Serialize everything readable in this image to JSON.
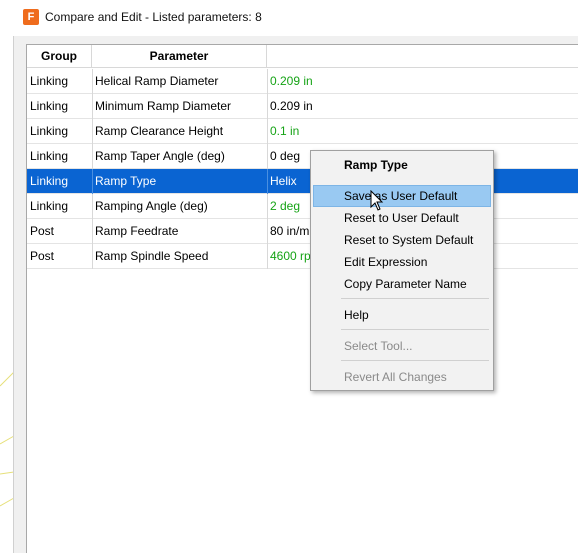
{
  "window": {
    "title": "Compare and Edit - Listed parameters: 8",
    "icon_letter": "F",
    "icon_color": "#ef6c1d"
  },
  "table": {
    "headers": [
      "Group",
      "Parameter",
      ""
    ],
    "rows": [
      {
        "group": "Linking",
        "parameter": "Helical Ramp Diameter",
        "value": "0.209 in",
        "modified": true
      },
      {
        "group": "Linking",
        "parameter": "Minimum Ramp Diameter",
        "value": "0.209 in",
        "modified": false
      },
      {
        "group": "Linking",
        "parameter": "Ramp Clearance Height",
        "value": "0.1 in",
        "modified": true
      },
      {
        "group": "Linking",
        "parameter": "Ramp Taper Angle (deg)",
        "value": "0 deg",
        "modified": false
      },
      {
        "group": "Linking",
        "parameter": "Ramp Type",
        "value": "Helix",
        "modified": false,
        "selected": true
      },
      {
        "group": "Linking",
        "parameter": "Ramping Angle (deg)",
        "value": "2 deg",
        "modified": true
      },
      {
        "group": "Post",
        "parameter": "Ramp Feedrate",
        "value": "80 in/m",
        "modified": false
      },
      {
        "group": "Post",
        "parameter": "Ramp Spindle Speed",
        "value": "4600 rp",
        "modified": true
      }
    ],
    "modified_color": "#16a316",
    "selection_color": "#0a64d2"
  },
  "context_menu": {
    "header": "Ramp Type",
    "items": [
      {
        "label": "Save as User Default",
        "state": "hover"
      },
      {
        "label": "Reset to User Default",
        "state": "normal"
      },
      {
        "label": "Reset to System Default",
        "state": "normal"
      },
      {
        "label": "Edit Expression",
        "state": "normal"
      },
      {
        "label": "Copy Parameter Name",
        "state": "normal"
      },
      {
        "label": "Help",
        "state": "normal"
      },
      {
        "label": "Select Tool...",
        "state": "disabled"
      },
      {
        "label": "Revert All Changes",
        "state": "disabled"
      }
    ]
  }
}
